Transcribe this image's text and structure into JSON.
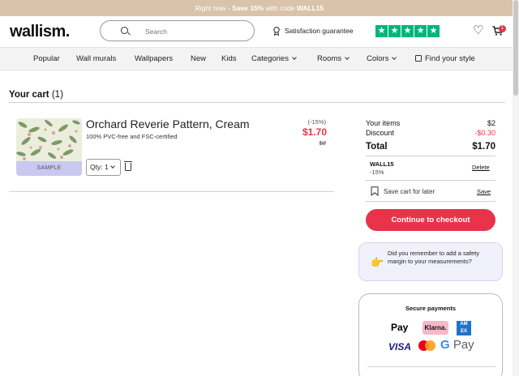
{
  "promo": {
    "prefix": "Right now - ",
    "offer": "Save 15%",
    "middle": " with code ",
    "code": "WALL15"
  },
  "header": {
    "logo": "wallism.",
    "search_placeholder": "Search",
    "guarantee": "Satisfaction guarantee",
    "cart_count": "1"
  },
  "nav": {
    "popular": "Popular",
    "murals": "Wall murals",
    "wallpapers": "Wallpapers",
    "new": "New",
    "kids": "Kids",
    "categories": "Categories",
    "rooms": "Rooms",
    "colors": "Colors",
    "find_style": "Find your style"
  },
  "cart": {
    "title": "Your cart",
    "count": "(1)",
    "item": {
      "name": "Orchard Reverie Pattern, Cream",
      "desc": "100% PVC-free and FSC-certified",
      "badge": "SAMPLE",
      "qty": "Qty: 1",
      "discount_pct": "(-15%)",
      "price": "$1.70",
      "old_price": "$2"
    }
  },
  "summary": {
    "items_label": "Your items",
    "items_value": "$2",
    "discount_label": "Discount",
    "discount_value": "-$0.30",
    "total_label": "Total",
    "total_value": "$1.70",
    "code": "WALL15",
    "code_pct": "-15%",
    "delete": "Delete",
    "save_later": "Save cart for later",
    "save": "Save",
    "checkout": "Continue to checkout"
  },
  "tip": {
    "text": "Did you remember to add a safety margin to your measurements?"
  },
  "secure": {
    "title": "Secure payments",
    "apple": "Pay",
    "klarna": "Klarna.",
    "amex": "AM EX",
    "visa": "VISA",
    "gpay_g": "G",
    "gpay": " Pay"
  },
  "colors": {
    "accent": "#e8334a",
    "promo_bg": "#d9c3a9",
    "trustpilot": "#00b67a",
    "sample_bg": "#c9c8f0"
  }
}
